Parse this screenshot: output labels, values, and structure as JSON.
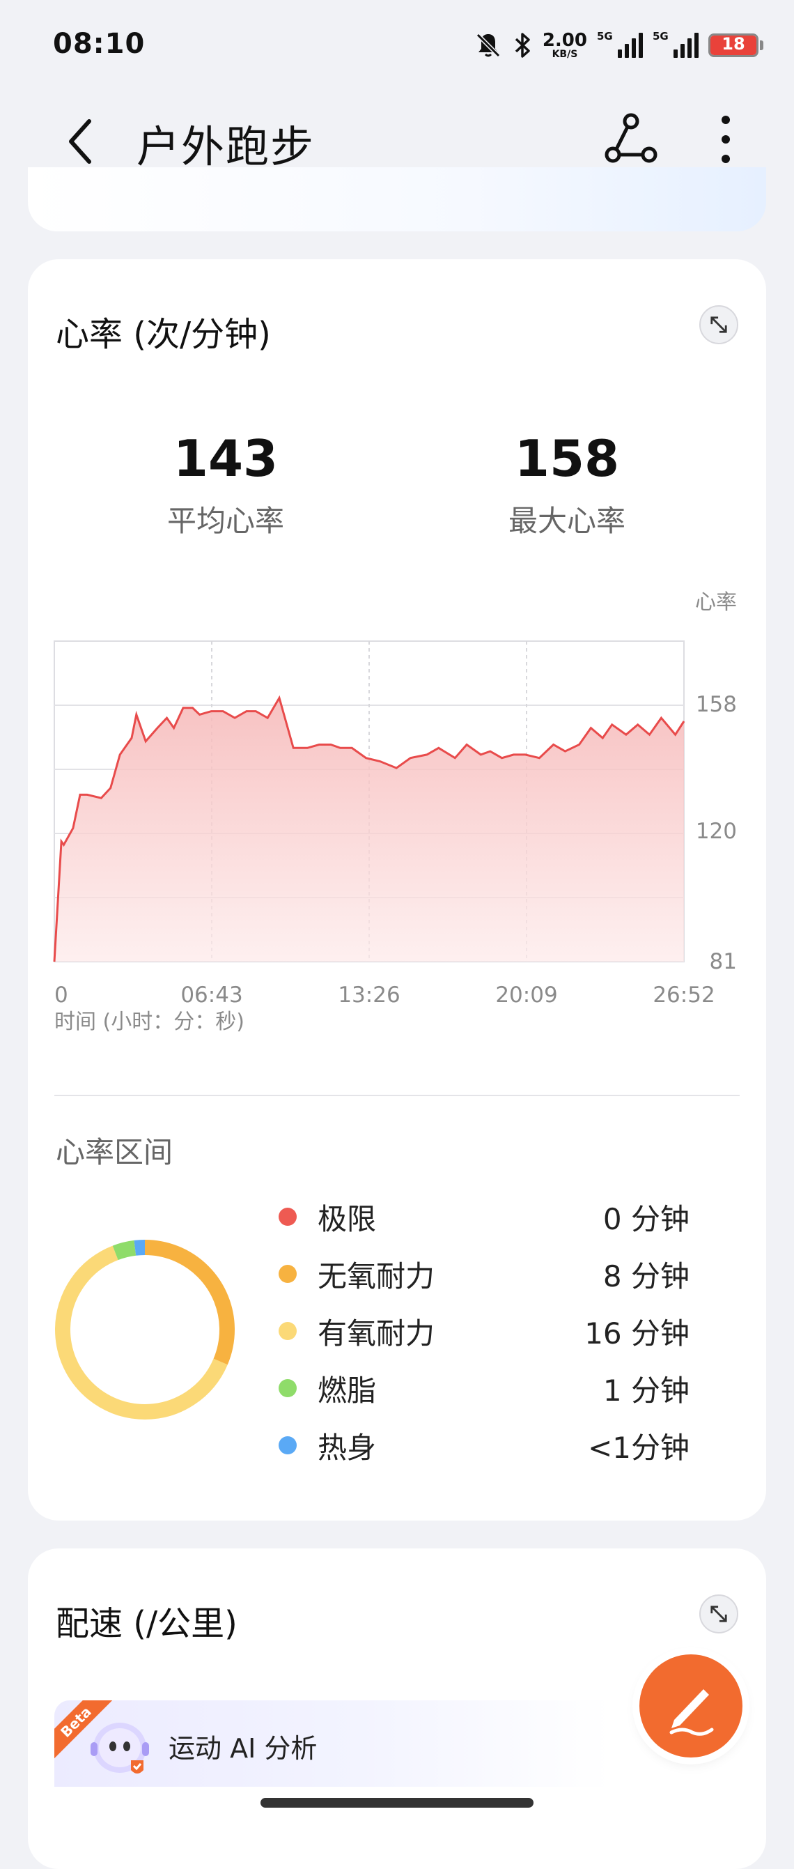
{
  "status_bar": {
    "time": "08:10",
    "net_speed_value": "2.00",
    "net_speed_unit": "KB/S",
    "signal1_label": "5G",
    "signal2_label": "5G",
    "battery_level": "18",
    "icons": [
      "bell-off-icon",
      "bluetooth-icon",
      "signal-icon",
      "battery-icon"
    ]
  },
  "header": {
    "title": "户外跑步",
    "icons": [
      "back-arrow-icon",
      "route-share-icon",
      "more-vertical-icon"
    ]
  },
  "heart_rate": {
    "title": "心率 (次/分钟)",
    "avg_value": "143",
    "avg_label": "平均心率",
    "max_value": "158",
    "max_label": "最大心率",
    "chart_unit": "心率",
    "x_axis_caption": "时间 (小时：分：秒)",
    "zones_title": "心率区间",
    "zones": [
      {
        "name": "极限",
        "value": "0 分钟",
        "color": "#ee5a52"
      },
      {
        "name": "无氧耐力",
        "value": "8 分钟",
        "color": "#f7b240"
      },
      {
        "name": "有氧耐力",
        "value": "16 分钟",
        "color": "#fbd977"
      },
      {
        "name": "燃脂",
        "value": "1 分钟",
        "color": "#8fdc6a"
      },
      {
        "name": "热身",
        "value": "<1分钟",
        "color": "#5aa9f5"
      }
    ]
  },
  "chart_data": {
    "type": "area",
    "title": "",
    "xlabel": "时间 (小时：分：秒)",
    "ylabel": "心率",
    "x_ticks": [
      "0",
      "06:43",
      "13:26",
      "20:09",
      "26:52"
    ],
    "y_ticks": [
      158,
      120,
      81
    ],
    "ylim": [
      81,
      177
    ],
    "xlim": [
      0,
      26.87
    ],
    "line_color": "#e84b4b",
    "grid": true,
    "series": [
      {
        "x": [
          0,
          0.3,
          0.4,
          0.8,
          1.1,
          1.4,
          2.0,
          2.4,
          2.8,
          3.3,
          3.5,
          3.9,
          4.4,
          4.8,
          5.1,
          5.5,
          5.9,
          6.2,
          6.7,
          7.2,
          7.7,
          8.2,
          8.6,
          9.1,
          9.6,
          10.2,
          10.8,
          11.3,
          11.8,
          12.2,
          12.7,
          13.3,
          13.9,
          14.6,
          15.2,
          15.9,
          16.4,
          17.1,
          17.6,
          18.2,
          18.6,
          19.1,
          19.6,
          20.1,
          20.7,
          21.3,
          21.8,
          22.4,
          22.9,
          23.4,
          23.8,
          24.4,
          24.9,
          25.4,
          25.9,
          26.5,
          26.87
        ],
        "values": [
          81,
          117,
          116,
          121,
          131,
          131,
          130,
          133,
          143,
          148,
          155,
          147,
          151,
          154,
          151,
          157,
          157,
          155,
          156,
          156,
          154,
          156,
          156,
          154,
          160,
          145,
          145,
          146,
          146,
          145,
          145,
          142,
          141,
          139,
          142,
          143,
          145,
          142,
          146,
          143,
          144,
          142,
          143,
          143,
          142,
          146,
          144,
          146,
          151,
          148,
          152,
          149,
          152,
          149,
          154,
          149,
          153
        ]
      }
    ]
  },
  "pace": {
    "title": "配速 (/公里)",
    "beta_label": "Beta",
    "ai_label": "运动 AI 分析"
  }
}
